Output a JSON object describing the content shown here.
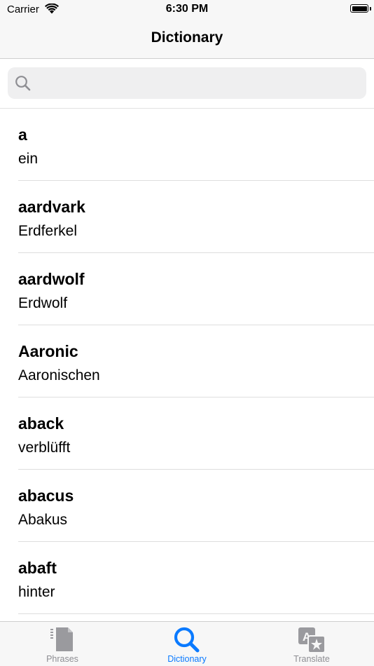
{
  "status_bar": {
    "carrier": "Carrier",
    "time": "6:30 PM",
    "battery_level": 1.0
  },
  "nav": {
    "title": "Dictionary"
  },
  "search": {
    "value": "",
    "placeholder": ""
  },
  "entries": [
    {
      "word": "a",
      "translation": "ein"
    },
    {
      "word": "aardvark",
      "translation": "Erdferkel"
    },
    {
      "word": "aardwolf",
      "translation": "Erdwolf"
    },
    {
      "word": "Aaronic",
      "translation": "Aaronischen"
    },
    {
      "word": "aback",
      "translation": "verblüfft"
    },
    {
      "word": "abacus",
      "translation": "Abakus"
    },
    {
      "word": "abaft",
      "translation": "hinter"
    }
  ],
  "tabs": [
    {
      "label": "Phrases",
      "icon": "document-stack-icon",
      "active": false
    },
    {
      "label": "Dictionary",
      "icon": "magnifier-icon",
      "active": true
    },
    {
      "label": "Translate",
      "icon": "translate-icon",
      "active": false
    }
  ],
  "colors": {
    "accent": "#0a7aff",
    "inactive": "#8e8e93",
    "bar_background": "#f7f7f7",
    "search_background": "#efeff0"
  }
}
